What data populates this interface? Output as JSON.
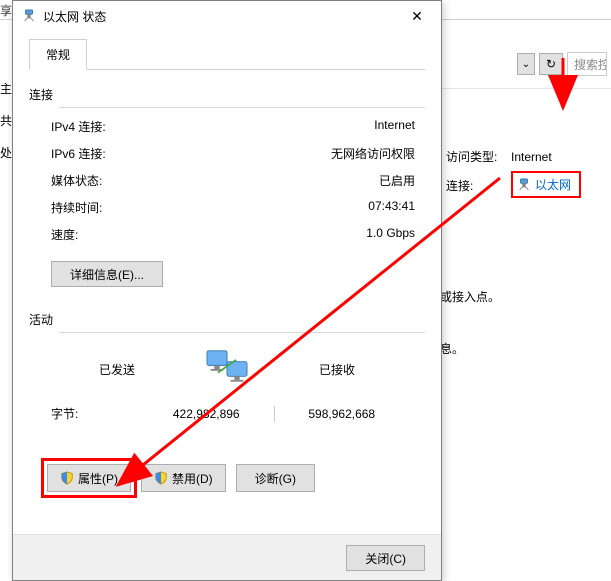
{
  "topBar": {
    "fragment": "享中心"
  },
  "leftNav": {
    "items": [
      "主",
      "共",
      "处"
    ]
  },
  "bgToolbar": {
    "searchPlaceholder": "搜索控"
  },
  "bgInfo": {
    "accessTypeLabel": "访问类型:",
    "accessTypeValue": "Internet",
    "connectLabel": "连接:",
    "connectValue": "以太网"
  },
  "bgNotes": {
    "note1": "或接入点。",
    "note2": "息。"
  },
  "dialog": {
    "title": "以太网 状态",
    "tab": "常规",
    "connection": {
      "header": "连接",
      "rows": [
        {
          "label": "IPv4 连接:",
          "value": "Internet"
        },
        {
          "label": "IPv6 连接:",
          "value": "无网络访问权限"
        },
        {
          "label": "媒体状态:",
          "value": "已启用"
        },
        {
          "label": "持续时间:",
          "value": "07:43:41"
        },
        {
          "label": "速度:",
          "value": "1.0 Gbps"
        }
      ],
      "detailsBtn": "详细信息(E)..."
    },
    "activity": {
      "header": "活动",
      "sentLabel": "已发送",
      "recvLabel": "已接收",
      "bytesLabel": "字节:",
      "sentValue": "422,982,896",
      "recvValue": "598,962,668"
    },
    "buttons": {
      "props": "属性(P)",
      "disable": "禁用(D)",
      "diag": "诊断(G)"
    },
    "closeBtn": "关闭(C)"
  }
}
